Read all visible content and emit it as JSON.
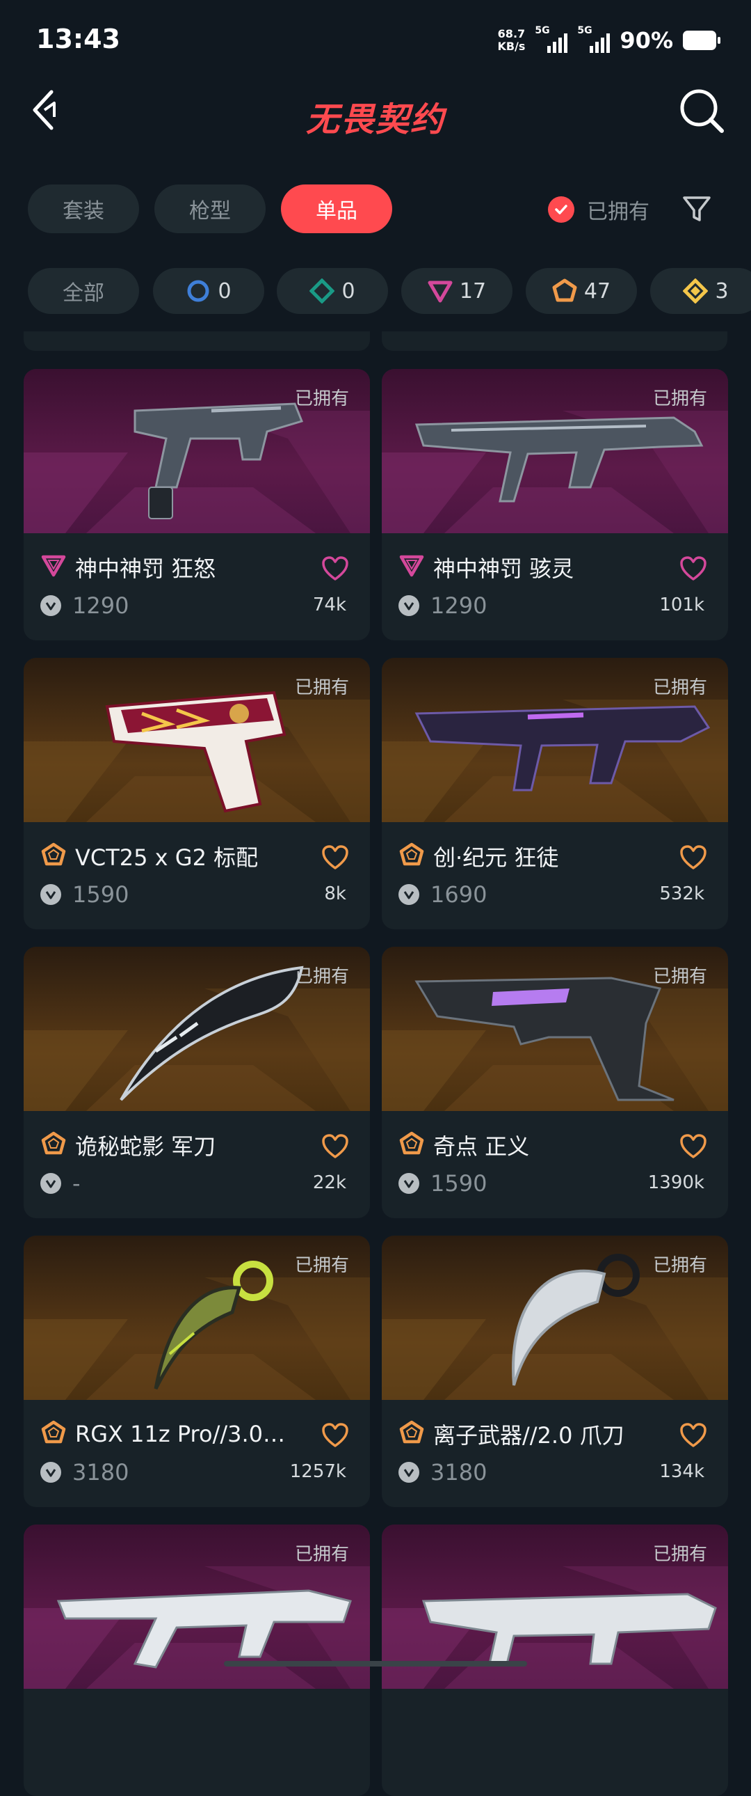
{
  "status_bar": {
    "time": "13:43",
    "net_speed_value": "68.7",
    "net_speed_unit": "KB/s",
    "sim1": "5G",
    "sim2": "5G",
    "battery": "90%"
  },
  "header": {
    "title": "无畏契约",
    "back_icon": "back-arrow",
    "search_icon": "magnifier"
  },
  "tabs": [
    {
      "label": "套装",
      "active": false
    },
    {
      "label": "枪型",
      "active": false
    },
    {
      "label": "单品",
      "active": true
    }
  ],
  "owned_filter": {
    "label": "已拥有",
    "checked": true
  },
  "chips": [
    {
      "label": "全部"
    },
    {
      "tier": "select",
      "color": "#3f7fd8",
      "count": "0"
    },
    {
      "tier": "deluxe",
      "color": "#1a9a86",
      "count": "0"
    },
    {
      "tier": "premium",
      "color": "#d4489b",
      "count": "17"
    },
    {
      "tier": "exclusive",
      "color": "#f09a4a",
      "count": "47"
    },
    {
      "tier": "ultra",
      "color": "#f4c64a",
      "count": "3"
    }
  ],
  "items": [
    {
      "name": "神中神罚 狂怒",
      "price": "1290",
      "likes": "74k",
      "owned": "已拥有",
      "tier": "premium",
      "tier_color": "#d4489b",
      "bg": "purple",
      "weapon": "spectre"
    },
    {
      "name": "神中神罚 骇灵",
      "price": "1290",
      "likes": "101k",
      "owned": "已拥有",
      "tier": "premium",
      "tier_color": "#d4489b",
      "bg": "purple",
      "weapon": "smg-long"
    },
    {
      "name": "VCT25 x G2 标配",
      "price": "1590",
      "likes": "8k",
      "owned": "已拥有",
      "tier": "exclusive",
      "tier_color": "#f09a4a",
      "bg": "gold",
      "weapon": "classic"
    },
    {
      "name": "创·纪元 狂徒",
      "price": "1690",
      "likes": "532k",
      "owned": "已拥有",
      "tier": "exclusive",
      "tier_color": "#f09a4a",
      "bg": "gold",
      "weapon": "vandal"
    },
    {
      "name": "诡秘蛇影 军刀",
      "price": "-",
      "likes": "22k",
      "owned": "已拥有",
      "tier": "exclusive",
      "tier_color": "#f09a4a",
      "bg": "gold",
      "weapon": "blade"
    },
    {
      "name": "奇点 正义",
      "price": "1590",
      "likes": "1390k",
      "owned": "已拥有",
      "tier": "exclusive",
      "tier_color": "#f09a4a",
      "bg": "gold",
      "weapon": "sheriff"
    },
    {
      "name": "RGX 11z Pro//3.0…",
      "price": "3180",
      "likes": "1257k",
      "owned": "已拥有",
      "tier": "exclusive",
      "tier_color": "#f09a4a",
      "bg": "gold",
      "weapon": "karambit-green"
    },
    {
      "name": "离子武器//2.0 爪刀",
      "price": "3180",
      "likes": "134k",
      "owned": "已拥有",
      "tier": "exclusive",
      "tier_color": "#f09a4a",
      "bg": "gold",
      "weapon": "karambit-white"
    },
    {
      "name": "",
      "price": "",
      "likes": "",
      "owned": "已拥有",
      "tier": "",
      "tier_color": "",
      "bg": "purple",
      "weapon": "rifle-white"
    },
    {
      "name": "",
      "price": "",
      "likes": "",
      "owned": "已拥有",
      "tier": "",
      "tier_color": "",
      "bg": "purple",
      "weapon": "rifle-white-2"
    }
  ]
}
